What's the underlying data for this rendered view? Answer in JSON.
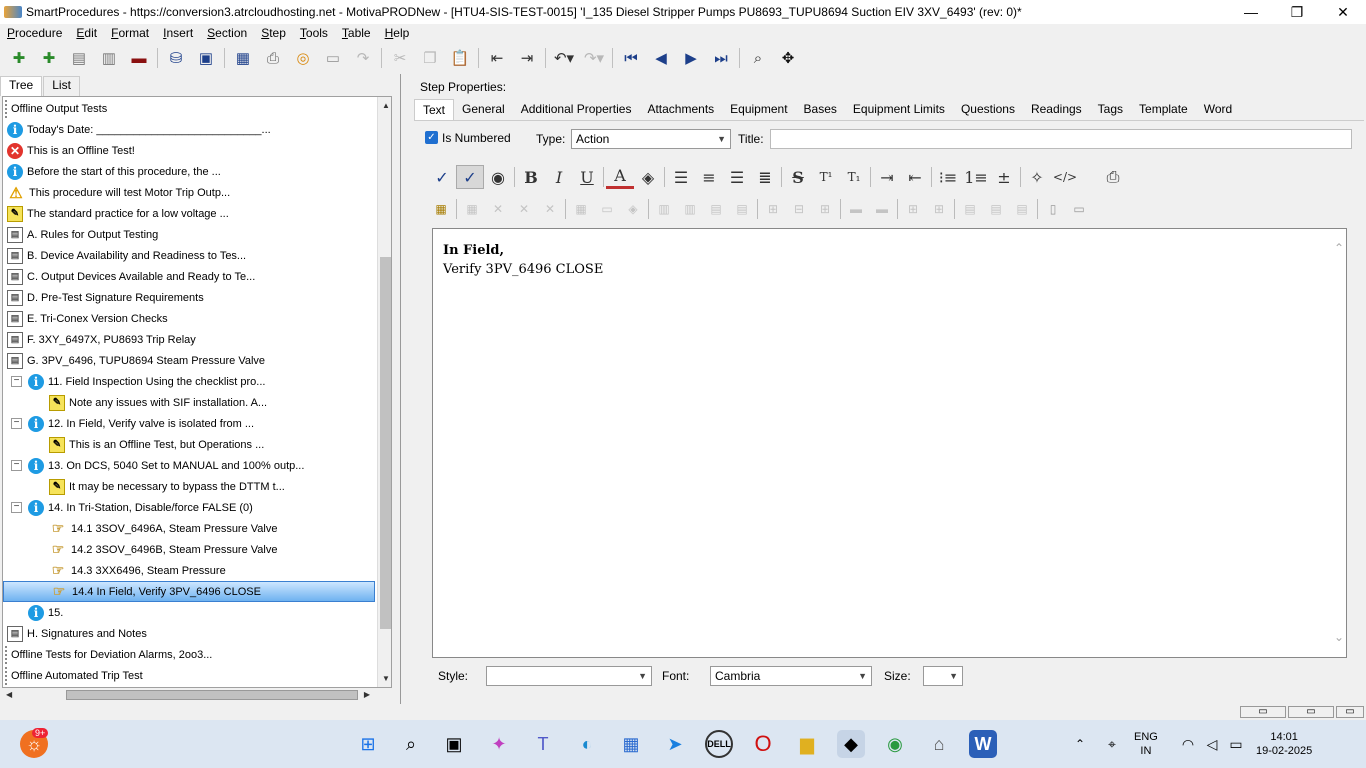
{
  "window": {
    "title": "SmartProcedures - https://conversion3.atrcloudhosting.net - MotivaPRODNew - [HTU4-SIS-TEST-0015] 'I_135 Diesel Stripper Pumps PU8693_TUPU8694 Suction EIV 3XV_6493' (rev: 0)*",
    "minimize": "—",
    "maximize": "❐",
    "close": "✕"
  },
  "menu": [
    "Procedure",
    "Edit",
    "Format",
    "Insert",
    "Section",
    "Step",
    "Tools",
    "Table",
    "Help"
  ],
  "toolbar": [
    "add-icon",
    "add-child-icon",
    "list-icon",
    "list-alt-icon",
    "remove-icon",
    "sep",
    "save-all-icon",
    "save-icon",
    "sep",
    "publish-icon",
    "print-icon",
    "sync-icon",
    "window-icon",
    "redo-disabled-icon",
    "sep",
    "cut-icon",
    "copy-icon",
    "paste-icon",
    "sep",
    "indent-icon",
    "outdent-icon",
    "sep",
    "undo-icon",
    "redo-icon",
    "sep",
    "first-icon",
    "prev-icon",
    "next-icon",
    "last-icon",
    "sep",
    "search-icon",
    "move-icon"
  ],
  "left_tabs": {
    "tree": "Tree",
    "list": "List"
  },
  "tree": [
    {
      "indent": 0,
      "icon": "doc",
      "text": "Offline Output Tests"
    },
    {
      "indent": 1,
      "icon": "info",
      "text": "Today's Date: ___________________________..."
    },
    {
      "indent": 1,
      "icon": "err",
      "text": "This is an Offline Test!"
    },
    {
      "indent": 1,
      "icon": "info",
      "text": "Before the start of this procedure, the ..."
    },
    {
      "indent": 1,
      "icon": "warn",
      "text": "This procedure will test Motor Trip Outp..."
    },
    {
      "indent": 1,
      "icon": "note",
      "text": "The standard practice for a low voltage ..."
    },
    {
      "indent": 1,
      "icon": "sect",
      "text": "A. Rules for Output Testing"
    },
    {
      "indent": 1,
      "icon": "sect",
      "text": "B. Device Availability and Readiness to Tes..."
    },
    {
      "indent": 1,
      "icon": "sect",
      "text": "C. Output Devices Available and Ready to Te..."
    },
    {
      "indent": 1,
      "icon": "sect",
      "text": "D. Pre-Test Signature Requirements"
    },
    {
      "indent": 1,
      "icon": "sect",
      "text": "E. Tri-Conex Version Checks"
    },
    {
      "indent": 1,
      "icon": "sect",
      "text": "F. 3XY_6497X, PU8693 Trip Relay"
    },
    {
      "indent": 1,
      "icon": "sect",
      "text": "G. 3PV_6496, TUPU8694 Steam Pressure Valve"
    },
    {
      "indent": 2,
      "icon": "info",
      "exp": "−",
      "text": "11. Field Inspection Using the checklist pro..."
    },
    {
      "indent": 3,
      "icon": "note",
      "text": "Note any issues with SIF installation. A..."
    },
    {
      "indent": 2,
      "icon": "info",
      "exp": "−",
      "text": "12. In Field, Verify valve is isolated from ..."
    },
    {
      "indent": 3,
      "icon": "note",
      "text": "This is an Offline Test, but Operations ..."
    },
    {
      "indent": 2,
      "icon": "info",
      "exp": "−",
      "text": "13. On DCS, 5040 Set to MANUAL and 100% outp..."
    },
    {
      "indent": 3,
      "icon": "note",
      "text": "It may be necessary to bypass the DTTM t..."
    },
    {
      "indent": 2,
      "icon": "info",
      "exp": "−",
      "text": "14. In Tri-Station, Disable/force FALSE (0)"
    },
    {
      "indent": 3,
      "icon": "hand",
      "text": "14.1 3SOV_6496A, Steam Pressure Valve"
    },
    {
      "indent": 3,
      "icon": "hand",
      "text": "14.2 3SOV_6496B, Steam Pressure Valve"
    },
    {
      "indent": 3,
      "icon": "hand",
      "text": "14.3 3XX6496, Steam Pressure"
    },
    {
      "indent": 3,
      "icon": "hand",
      "text": "14.4 In Field, Verify 3PV_6496 CLOSE",
      "selected": true
    },
    {
      "indent": 2,
      "icon": "info",
      "text": "15."
    },
    {
      "indent": 1,
      "icon": "sect",
      "text": "H. Signatures and Notes"
    },
    {
      "indent": 0,
      "icon": "doc",
      "text": "Offline Tests for Deviation Alarms, 2oo3..."
    },
    {
      "indent": 0,
      "icon": "doc",
      "text": "Offline Automated Trip Test"
    }
  ],
  "right": {
    "step_properties": "Step Properties:",
    "tabs": [
      "Text",
      "General",
      "Additional Properties",
      "Attachments",
      "Equipment",
      "Bases",
      "Equipment Limits",
      "Questions",
      "Readings",
      "Tags",
      "Template",
      "Word"
    ],
    "is_numbered_label": "Is Numbered",
    "is_numbered": true,
    "type_label": "Type:",
    "type_value": "Action",
    "title_label": "Title:",
    "title_value": "",
    "editor_line1": "In Field,",
    "editor_line2": "Verify 3PV_6496 CLOSE",
    "style_label": "Style:",
    "style_value": "",
    "font_label": "Font:",
    "font_value": "Cambria",
    "size_label": "Size:",
    "size_value": ""
  },
  "format_buttons": [
    {
      "name": "spellcheck-icon",
      "g": "✓"
    },
    {
      "name": "spellcheck-auto-icon",
      "g": "✓",
      "on": true
    },
    {
      "name": "color-wheel-icon",
      "g": "◉"
    },
    {
      "name": "sep"
    },
    {
      "name": "bold-icon",
      "g": "B"
    },
    {
      "name": "italic-icon",
      "g": "I"
    },
    {
      "name": "underline-icon",
      "g": "U"
    },
    {
      "name": "sep"
    },
    {
      "name": "font-color-icon",
      "g": "A"
    },
    {
      "name": "fill-color-icon",
      "g": "◈"
    },
    {
      "name": "sep"
    },
    {
      "name": "align-left-icon",
      "g": "☰"
    },
    {
      "name": "align-center-icon",
      "g": "≡"
    },
    {
      "name": "align-right-icon",
      "g": "☰"
    },
    {
      "name": "align-justify-icon",
      "g": "≣"
    },
    {
      "name": "sep"
    },
    {
      "name": "strikethrough-icon",
      "g": "S"
    },
    {
      "name": "superscript-icon",
      "g": "T¹"
    },
    {
      "name": "subscript-icon",
      "g": "T₁"
    },
    {
      "name": "sep"
    },
    {
      "name": "indent-right-icon",
      "g": "⇥"
    },
    {
      "name": "indent-left-icon",
      "g": "⇤"
    },
    {
      "name": "sep"
    },
    {
      "name": "bullet-list-icon",
      "g": "⁝≡"
    },
    {
      "name": "numbered-list-icon",
      "g": "1≡"
    },
    {
      "name": "insert-line-icon",
      "g": "±"
    },
    {
      "name": "sep"
    },
    {
      "name": "magic-wand-icon",
      "g": "✧"
    },
    {
      "name": "html-source-icon",
      "g": "</>"
    },
    {
      "name": "spacer",
      "g": ""
    },
    {
      "name": "printer-icon",
      "g": "⎙"
    }
  ],
  "taskbar": {
    "notif_badge": "9+",
    "lang_top": "ENG",
    "lang_bottom": "IN",
    "time": "14:01",
    "date": "19-02-2025",
    "icons": [
      "windows-start-icon",
      "search-icon",
      "task-view-icon",
      "copilot-icon",
      "teams-icon",
      "edge-icon",
      "store-icon",
      "azure-icon",
      "dell-icon",
      "opera-icon",
      "file-explorer-icon",
      "smartprocedures-icon",
      "chrome-icon",
      "app-icon",
      "word-icon"
    ]
  },
  "colors": {
    "selection": "#6fb2f0",
    "accent": "#1f6fd0",
    "taskbar": "#dce6f2"
  }
}
